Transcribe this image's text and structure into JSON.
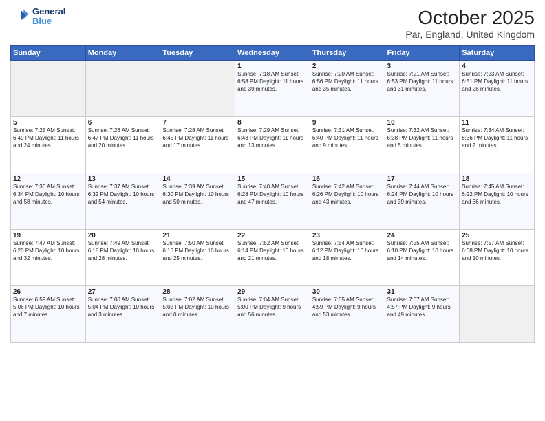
{
  "header": {
    "logo_line1": "General",
    "logo_line2": "Blue",
    "title": "October 2025",
    "subtitle": "Par, England, United Kingdom"
  },
  "columns": [
    "Sunday",
    "Monday",
    "Tuesday",
    "Wednesday",
    "Thursday",
    "Friday",
    "Saturday"
  ],
  "weeks": [
    [
      {
        "day": "",
        "content": ""
      },
      {
        "day": "",
        "content": ""
      },
      {
        "day": "",
        "content": ""
      },
      {
        "day": "1",
        "content": "Sunrise: 7:18 AM\nSunset: 6:58 PM\nDaylight: 11 hours\nand 39 minutes."
      },
      {
        "day": "2",
        "content": "Sunrise: 7:20 AM\nSunset: 6:56 PM\nDaylight: 11 hours\nand 35 minutes."
      },
      {
        "day": "3",
        "content": "Sunrise: 7:21 AM\nSunset: 6:53 PM\nDaylight: 11 hours\nand 31 minutes."
      },
      {
        "day": "4",
        "content": "Sunrise: 7:23 AM\nSunset: 6:51 PM\nDaylight: 11 hours\nand 28 minutes."
      }
    ],
    [
      {
        "day": "5",
        "content": "Sunrise: 7:25 AM\nSunset: 6:49 PM\nDaylight: 11 hours\nand 24 minutes."
      },
      {
        "day": "6",
        "content": "Sunrise: 7:26 AM\nSunset: 6:47 PM\nDaylight: 11 hours\nand 20 minutes."
      },
      {
        "day": "7",
        "content": "Sunrise: 7:28 AM\nSunset: 6:45 PM\nDaylight: 11 hours\nand 17 minutes."
      },
      {
        "day": "8",
        "content": "Sunrise: 7:29 AM\nSunset: 6:43 PM\nDaylight: 11 hours\nand 13 minutes."
      },
      {
        "day": "9",
        "content": "Sunrise: 7:31 AM\nSunset: 6:40 PM\nDaylight: 11 hours\nand 9 minutes."
      },
      {
        "day": "10",
        "content": "Sunrise: 7:32 AM\nSunset: 6:38 PM\nDaylight: 11 hours\nand 5 minutes."
      },
      {
        "day": "11",
        "content": "Sunrise: 7:34 AM\nSunset: 6:36 PM\nDaylight: 11 hours\nand 2 minutes."
      }
    ],
    [
      {
        "day": "12",
        "content": "Sunrise: 7:36 AM\nSunset: 6:34 PM\nDaylight: 10 hours\nand 58 minutes."
      },
      {
        "day": "13",
        "content": "Sunrise: 7:37 AM\nSunset: 6:32 PM\nDaylight: 10 hours\nand 54 minutes."
      },
      {
        "day": "14",
        "content": "Sunrise: 7:39 AM\nSunset: 6:30 PM\nDaylight: 10 hours\nand 50 minutes."
      },
      {
        "day": "15",
        "content": "Sunrise: 7:40 AM\nSunset: 6:28 PM\nDaylight: 10 hours\nand 47 minutes."
      },
      {
        "day": "16",
        "content": "Sunrise: 7:42 AM\nSunset: 6:26 PM\nDaylight: 10 hours\nand 43 minutes."
      },
      {
        "day": "17",
        "content": "Sunrise: 7:44 AM\nSunset: 6:24 PM\nDaylight: 10 hours\nand 39 minutes."
      },
      {
        "day": "18",
        "content": "Sunrise: 7:45 AM\nSunset: 6:22 PM\nDaylight: 10 hours\nand 36 minutes."
      }
    ],
    [
      {
        "day": "19",
        "content": "Sunrise: 7:47 AM\nSunset: 6:20 PM\nDaylight: 10 hours\nand 32 minutes."
      },
      {
        "day": "20",
        "content": "Sunrise: 7:49 AM\nSunset: 6:18 PM\nDaylight: 10 hours\nand 28 minutes."
      },
      {
        "day": "21",
        "content": "Sunrise: 7:50 AM\nSunset: 6:16 PM\nDaylight: 10 hours\nand 25 minutes."
      },
      {
        "day": "22",
        "content": "Sunrise: 7:52 AM\nSunset: 6:14 PM\nDaylight: 10 hours\nand 21 minutes."
      },
      {
        "day": "23",
        "content": "Sunrise: 7:54 AM\nSunset: 6:12 PM\nDaylight: 10 hours\nand 18 minutes."
      },
      {
        "day": "24",
        "content": "Sunrise: 7:55 AM\nSunset: 6:10 PM\nDaylight: 10 hours\nand 14 minutes."
      },
      {
        "day": "25",
        "content": "Sunrise: 7:57 AM\nSunset: 6:08 PM\nDaylight: 10 hours\nand 10 minutes."
      }
    ],
    [
      {
        "day": "26",
        "content": "Sunrise: 6:59 AM\nSunset: 5:06 PM\nDaylight: 10 hours\nand 7 minutes."
      },
      {
        "day": "27",
        "content": "Sunrise: 7:00 AM\nSunset: 5:04 PM\nDaylight: 10 hours\nand 3 minutes."
      },
      {
        "day": "28",
        "content": "Sunrise: 7:02 AM\nSunset: 5:02 PM\nDaylight: 10 hours\nand 0 minutes."
      },
      {
        "day": "29",
        "content": "Sunrise: 7:04 AM\nSunset: 5:00 PM\nDaylight: 9 hours\nand 56 minutes."
      },
      {
        "day": "30",
        "content": "Sunrise: 7:05 AM\nSunset: 4:59 PM\nDaylight: 9 hours\nand 53 minutes."
      },
      {
        "day": "31",
        "content": "Sunrise: 7:07 AM\nSunset: 4:57 PM\nDaylight: 9 hours\nand 49 minutes."
      },
      {
        "day": "",
        "content": ""
      }
    ]
  ]
}
